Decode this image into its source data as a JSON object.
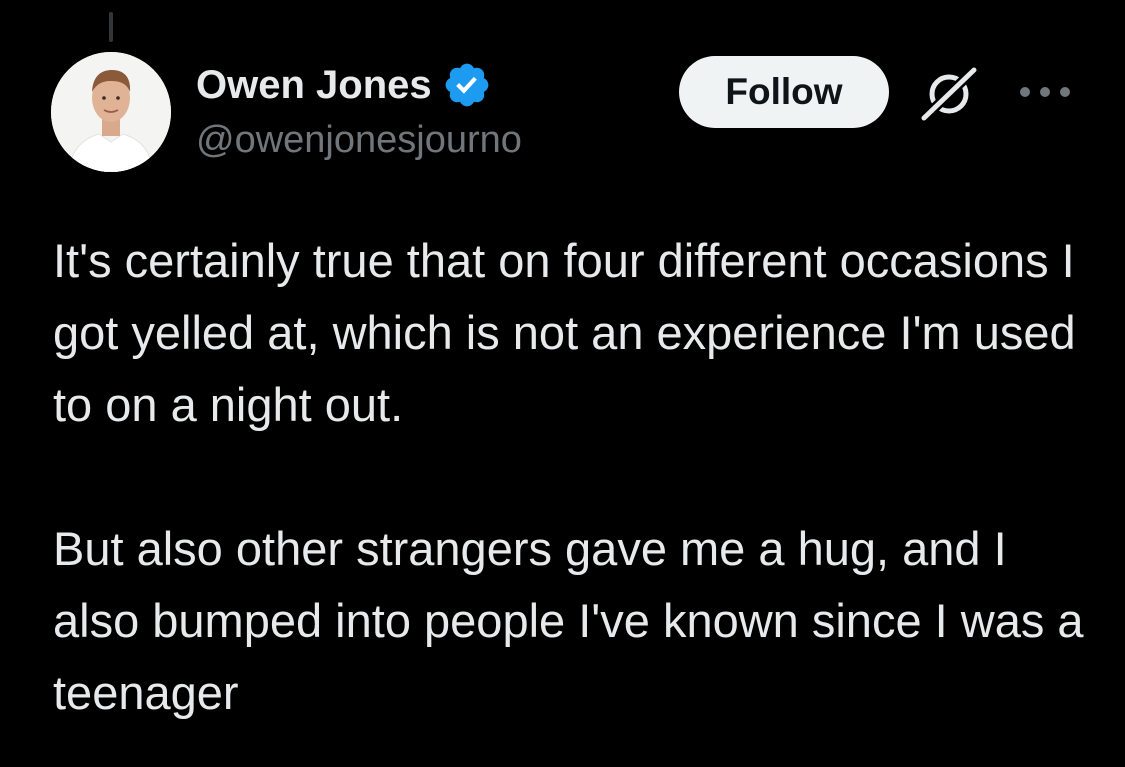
{
  "tweet": {
    "author": {
      "display_name": "Owen Jones",
      "handle": "@owenjonesjourno",
      "verified": true,
      "verified_color": "#1d9bf0"
    },
    "follow_label": "Follow",
    "paragraphs": [
      "It's certainly true that on four different occasions I got yelled at, which is not an experience I'm used to on a night out.",
      "But also other strangers gave me a hug, and I also bumped into people I've known since I was a teenager"
    ]
  },
  "icons": {
    "grok": "grok-icon",
    "more": "more-options-icon",
    "verified": "verified-badge-icon"
  },
  "colors": {
    "background": "#000000",
    "primary_text": "#e7e9ea",
    "secondary_text": "#71767b",
    "follow_button_bg": "#eff3f4",
    "follow_button_text": "#0f1419"
  }
}
